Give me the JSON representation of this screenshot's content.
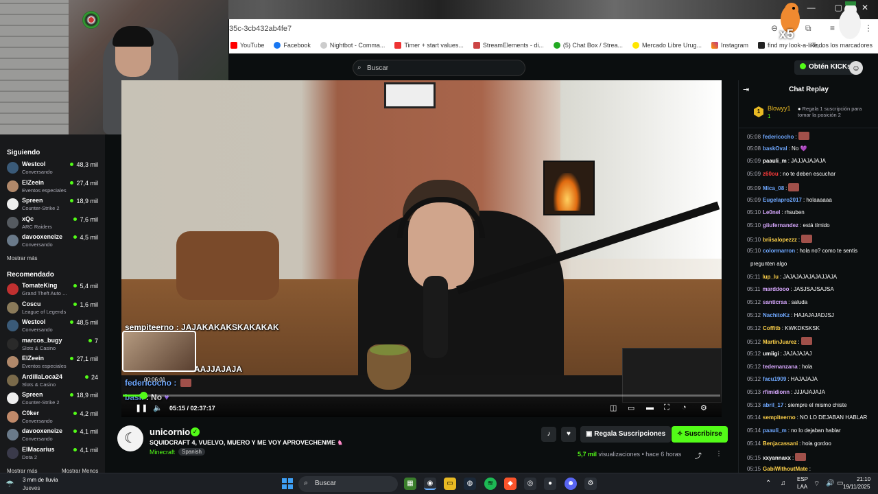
{
  "browser": {
    "url_fragment": "35c-3cb432ab4fe7",
    "bookmarks": [
      "YouTube",
      "Facebook",
      "Nightbot - Comma...",
      "Timer + start values...",
      "StreamElements - di...",
      "(5) Chat Box / Strea...",
      "Mercado Libre Urug...",
      "Instagram",
      "find my look-a-like,..."
    ],
    "bookmark_all": "Todos los marcadores",
    "window_controls": [
      "—",
      "▢",
      "✕"
    ]
  },
  "header": {
    "search_placeholder": "Buscar",
    "kicks_label": "Obtén KICKs"
  },
  "sidebar": {
    "following_title": "Siguiendo",
    "following": [
      {
        "name": "Westcol",
        "game": "Conversando",
        "viewers": "48,3 mil",
        "color": "#3a5a78"
      },
      {
        "name": "ElZeein",
        "game": "Eventos especiales",
        "viewers": "27,4 mil",
        "color": "#b0886a"
      },
      {
        "name": "Spreen",
        "game": "Counter-Strike 2",
        "viewers": "18,9 mil",
        "color": "#eeeeee"
      },
      {
        "name": "xQc",
        "game": "ARC Raiders",
        "viewers": "7,6 mil",
        "color": "#555a60"
      },
      {
        "name": "davooxeneize",
        "game": "Conversando",
        "viewers": "4,5 mil",
        "color": "#6a7a8a"
      }
    ],
    "show_more": "Mostrar más",
    "recommended_title": "Recomendado",
    "recommended": [
      {
        "name": "TomateKing",
        "game": "Grand Theft Auto ...",
        "viewers": "5,4 mil",
        "color": "#c03030"
      },
      {
        "name": "Coscu",
        "game": "League of Legends",
        "viewers": "1,6 mil",
        "color": "#8a7a5a"
      },
      {
        "name": "Westcol",
        "game": "Conversando",
        "viewers": "48,5 mil",
        "color": "#3a5a78"
      },
      {
        "name": "marcos_bugy",
        "game": "Slots & Casino",
        "viewers": "7",
        "color": "#2a2a2a"
      },
      {
        "name": "ElZeein",
        "game": "Eventos especiales",
        "viewers": "27,1 mil",
        "color": "#b0886a"
      },
      {
        "name": "ArdillaLoca24",
        "game": "Slots & Casino",
        "viewers": "24",
        "color": "#7a6a4a"
      },
      {
        "name": "Spreen",
        "game": "Counter-Strike 2",
        "viewers": "18,9 mil",
        "color": "#eeeeee"
      },
      {
        "name": "C0ker",
        "game": "Conversando",
        "viewers": "4,2 mil",
        "color": "#c08a6a"
      },
      {
        "name": "davooxeneize",
        "game": "Conversando",
        "viewers": "4,1 mil",
        "color": "#6a7a8a"
      },
      {
        "name": "ElMacarius",
        "game": "Dota 2",
        "viewers": "4,1 mil",
        "color": "#3a3a4a"
      }
    ],
    "show_more_2": "Mostrar más",
    "show_less": "Mostrar Menos"
  },
  "video": {
    "overlay_chat": [
      {
        "user": "sempiteerno",
        "text": "JAJAKAKAKSKAKAKAK"
      },
      {
        "text": "AAJJAJAJA"
      },
      {
        "user": "federicocho",
        "text": ""
      },
      {
        "user": "bask",
        "text": "No"
      }
    ],
    "preview_time": "00:06:01",
    "current_time": "05:15",
    "total_time": "02:37:17",
    "progress_fraction": 0.034
  },
  "stream": {
    "channel": "unicornio",
    "title": "SQUIDCRAFT 4, VUELVO, MUERO Y ME VOY APROVECHENME",
    "category": "Minecraft",
    "language": "Spanish",
    "gift_label": "Regala Suscripciones",
    "subscribe_label": "Suscribirse",
    "views": "5,7 mil",
    "views_suffix": "visualizaciones",
    "ago": "hace 6 horas"
  },
  "chat": {
    "title": "Chat Replay",
    "pinned_user": "Blowyy1",
    "pinned_count": "1",
    "pinned_badge": "1",
    "pinned_text": "Regala 1 suscripción para tomar la posición 2",
    "messages": [
      {
        "t": "05:08",
        "u": "federicocho",
        "c": "#6fa8ff",
        "m": ":",
        "emote": true
      },
      {
        "t": "05:08",
        "u": "baskOval",
        "c": "#6fa8ff",
        "m": ": No 💜"
      },
      {
        "t": "05:09",
        "u": "paauli_m",
        "c": "#ffffff",
        "m": ": JAJJAJAJAJA"
      },
      {
        "t": "05:09",
        "u": "z60ou",
        "c": "#ff3b3b",
        "m": ": no te deben escuchar"
      },
      {
        "t": "05:09",
        "u": "Mica_08",
        "c": "#6fa8ff",
        "m": ":",
        "emote": true
      },
      {
        "t": "05:09",
        "u": "Eugelapro2017",
        "c": "#6fa8ff",
        "m": ": holaaaaaa"
      },
      {
        "t": "05:10",
        "u": "Le0nel",
        "c": "#d8a8ff",
        "m": ": rhsuben"
      },
      {
        "t": "05:10",
        "u": "giiufernandez",
        "c": "#d8a8ff",
        "m": ": está tímido"
      },
      {
        "t": "05:10",
        "u": "briisalopezzz",
        "c": "#ffd24a",
        "m": ":",
        "emote": true
      },
      {
        "t": "05:10",
        "u": "colormarron",
        "c": "#6fa8ff",
        "m": ": hola no? como te sentis"
      },
      {
        "t": "",
        "u": "",
        "c": "#ffffff",
        "m": "pregunten algo"
      },
      {
        "t": "05:11",
        "u": "lup_lu",
        "c": "#ffd24a",
        "m": ": JAJAJAJAJAJAJJAJA"
      },
      {
        "t": "05:11",
        "u": "marddooo",
        "c": "#d8a8ff",
        "m": ": JASJSAJSAJSA"
      },
      {
        "t": "05:12",
        "u": "santicraa",
        "c": "#d8a8ff",
        "m": ": saluda"
      },
      {
        "t": "05:12",
        "u": "NachitoKz",
        "c": "#6fa8ff",
        "m": ": HAJAJAJADJSJ"
      },
      {
        "t": "05:12",
        "u": "Coffitb",
        "c": "#ffd24a",
        "m": ": KWKDKSKSK"
      },
      {
        "t": "05:12",
        "u": "MartinJuarez",
        "c": "#ffd24a",
        "m": ":",
        "emote": true
      },
      {
        "t": "05:12",
        "u": "umiigi",
        "c": "#ffffff",
        "m": ": JAJAJAJAJ"
      },
      {
        "t": "05:12",
        "u": "tedemanzana",
        "c": "#d8a8ff",
        "m": ": hola"
      },
      {
        "t": "05:12",
        "u": "facu1909",
        "c": "#6fa8ff",
        "m": ": HAJAJAJA"
      },
      {
        "t": "05:13",
        "u": "rfimidionn",
        "c": "#d8a8ff",
        "m": ": JJJAJAJAJA"
      },
      {
        "t": "05:13",
        "u": "abril_17",
        "c": "#6fa8ff",
        "m": ": siempre el mismo chiste"
      },
      {
        "t": "05:14",
        "u": "sempiteerno",
        "c": "#ffd24a",
        "m": ": NO LO DEJABAN HABLAR"
      },
      {
        "t": "05:14",
        "u": "paauli_m",
        "c": "#6fa8ff",
        "m": ": no lo dejaban hablar"
      },
      {
        "t": "05:14",
        "u": "Benjacassani",
        "c": "#ffd24a",
        "m": ": hola gordoo"
      },
      {
        "t": "05:15",
        "u": "xxyannaxx",
        "c": "#ffffff",
        "m": ":",
        "emote": true
      },
      {
        "t": "05:15",
        "u": "GabiWithoutMate",
        "c": "#ffd24a",
        "m": ":"
      }
    ]
  },
  "overlay": {
    "multiplier": "x5"
  },
  "taskbar": {
    "weather_temp": "3 mm de lluvia",
    "weather_day": "Jueves",
    "search": "Buscar",
    "lang1": "ESP",
    "lang2": "LAA",
    "time": "21:10",
    "date": "19/11/2025"
  }
}
